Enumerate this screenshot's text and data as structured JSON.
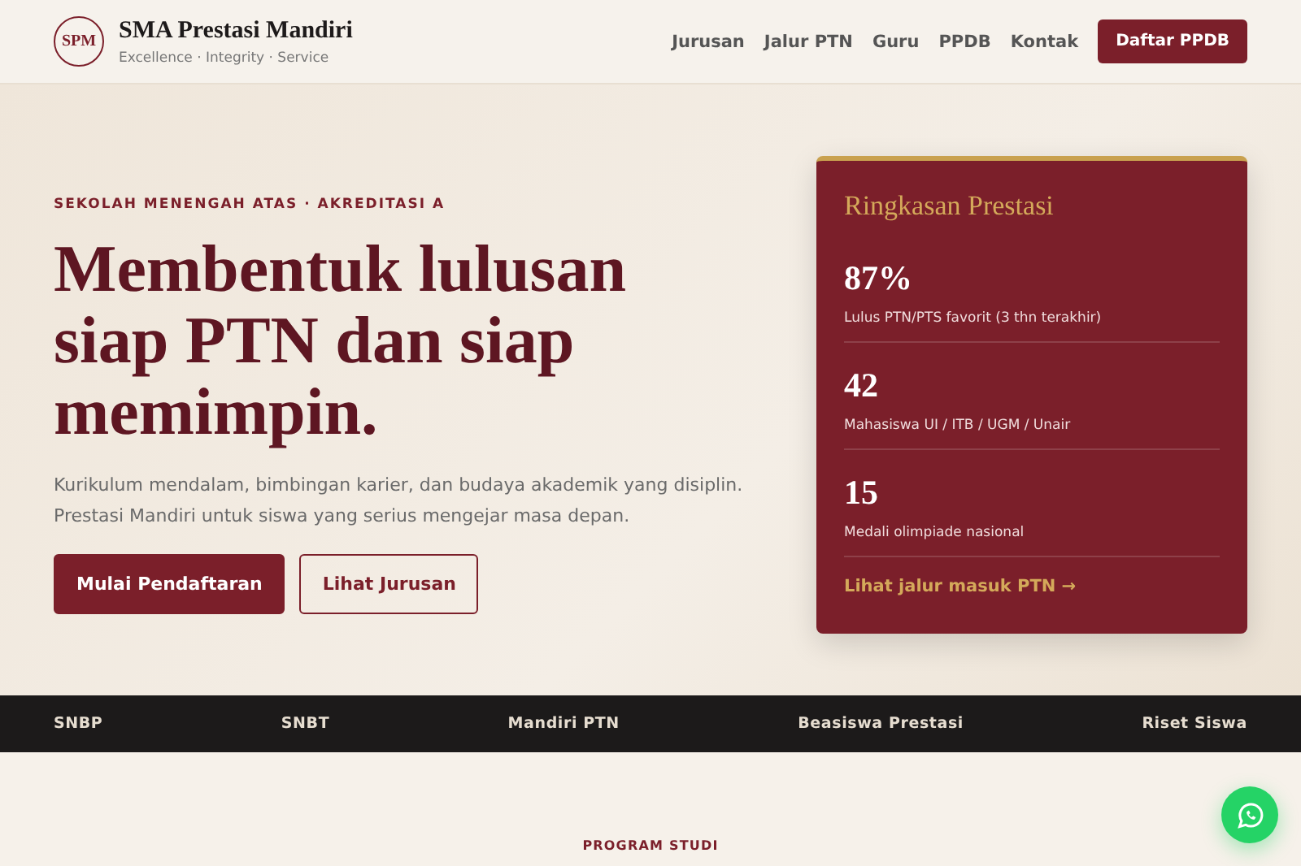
{
  "header": {
    "logo": "SPM",
    "title": "SMA Prestasi Mandiri",
    "tagline": "Excellence · Integrity · Service",
    "nav": [
      "Jurusan",
      "Jalur PTN",
      "Guru",
      "PPDB",
      "Kontak"
    ],
    "cta": "Daftar PPDB"
  },
  "hero": {
    "eyebrow": "SEKOLAH MENENGAH ATAS · AKREDITASI A",
    "headline": [
      "Membentuk lulusan",
      "siap PTN dan siap",
      "memimpin."
    ],
    "lead": [
      "Kurikulum mendalam, bimbingan karier, dan budaya akademik yang disiplin.",
      "Prestasi Mandiri untuk siswa yang serius mengejar masa depan."
    ],
    "buttons": [
      {
        "label": "Mulai Pendaftaran",
        "kind": "primary"
      },
      {
        "label": "Lihat Jurusan",
        "kind": "outline"
      }
    ]
  },
  "summary": {
    "title": "Ringkasan Prestasi",
    "stats": [
      {
        "value": "87%",
        "label": "Lulus PTN/PTS favorit (3 thn terakhir)"
      },
      {
        "value": "42",
        "label": "Mahasiswa UI / ITB / UGM / Unair"
      },
      {
        "value": "15",
        "label": "Medali olimpiade nasional"
      }
    ],
    "link": "Lihat jalur masuk PTN →"
  },
  "strip": [
    "SNBP",
    "SNBT",
    "Mandiri PTN",
    "Beasiswa Prestasi",
    "Riset Siswa"
  ],
  "section": {
    "eyebrow": "PROGRAM STUDI"
  }
}
